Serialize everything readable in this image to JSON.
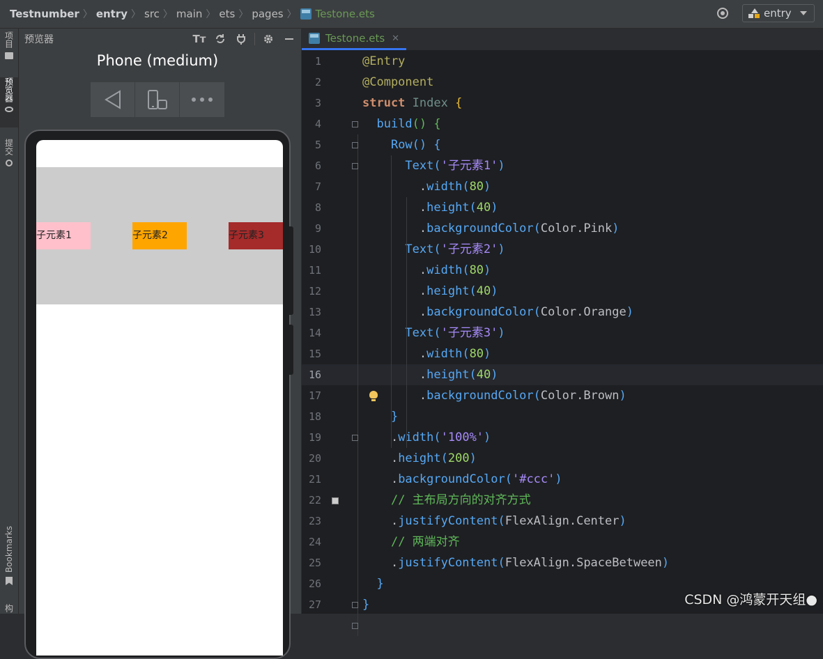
{
  "breadcrumb": {
    "items": [
      "Testnumber",
      "entry",
      "src",
      "main",
      "ets",
      "pages"
    ],
    "file": "Testone.ets"
  },
  "run_config": {
    "label": "entry"
  },
  "left_strip": {
    "project": "项目",
    "previewer": "预览器",
    "commit": "提交",
    "bookmarks": "Bookmarks",
    "structure": "构"
  },
  "previewer": {
    "title": "预览器",
    "device_name": "Phone (medium)",
    "children": [
      "子元素1",
      "子元素2",
      "子元素3"
    ],
    "child_colors": [
      "#ffc0cb",
      "#ffa500",
      "#a52a2a"
    ],
    "row_color": "#cccccc"
  },
  "editor": {
    "tab_label": "Testone.ets",
    "current_line": 16,
    "lines": [
      "@Entry",
      "@Component",
      "struct Index {",
      "  build() {",
      "    Row() {",
      "      Text('子元素1')",
      "        .width(80)",
      "        .height(40)",
      "        .backgroundColor(Color.Pink)",
      "      Text('子元素2')",
      "        .width(80)",
      "        .height(40)",
      "        .backgroundColor(Color.Orange)",
      "      Text('子元素3')",
      "        .width(80)",
      "        .height(40)",
      "        .backgroundColor(Color.Brown)",
      "    }",
      "    .width('100%')",
      "    .height(200)",
      "    .backgroundColor('#ccc')",
      "    // 主布局方向的对齐方式",
      "    .justifyContent(FlexAlign.Center)",
      "    // 两端对齐",
      "    .justifyContent(FlexAlign.SpaceBetween)",
      "  }",
      "}"
    ]
  },
  "watermark": "CSDN @鸿蒙开天组●"
}
